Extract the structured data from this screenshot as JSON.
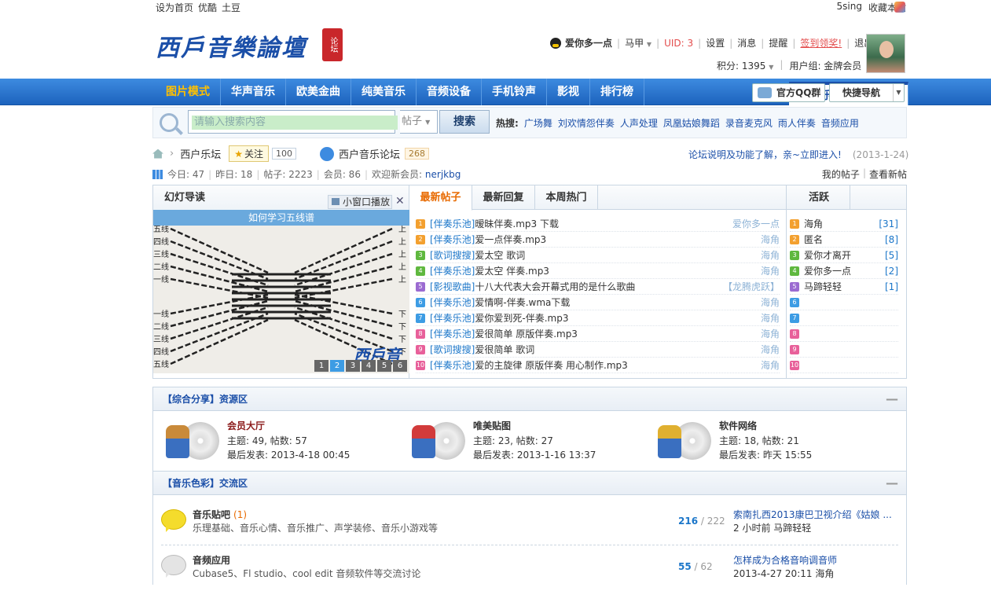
{
  "topbar": {
    "set_home": "设为首页",
    "youku": "优酷",
    "tudou": "土豆",
    "fivesing": "5sing",
    "bookmark": "收藏本站"
  },
  "logo": {
    "text": "西戶音樂論壇",
    "seal": "论坛"
  },
  "user": {
    "name": "爱你多一点",
    "maJia": "马甲",
    "uid": "UID: 3",
    "settings": "设置",
    "messages": "消息",
    "remind": "提醒",
    "signin": "签到领奖!",
    "logout": "退出",
    "points": "积分: 1395",
    "group": "用户组: 金牌会员"
  },
  "nav": {
    "items": [
      "西户乐坛",
      "图片模式",
      "华声音乐",
      "欧美金曲",
      "纯美音乐",
      "音频设备",
      "手机铃声",
      "影视",
      "排行榜"
    ],
    "qq_group": "官方QQ群",
    "quick_nav": "快捷导航"
  },
  "search": {
    "placeholder": "请输入搜索内容",
    "type": "帖子",
    "button": "搜索",
    "hot_label": "热搜:",
    "hot": [
      "广场舞",
      "刘欢情怨伴奏",
      "人声处理",
      "凤凰姑娘舞蹈",
      "录音麦克风",
      "雨人伴奏",
      "音频应用"
    ]
  },
  "crumb": {
    "home": "西户乐坛",
    "follow": "关注",
    "follow_count": "100",
    "forum": "西户音乐论坛",
    "forum_count": "268"
  },
  "notice": {
    "text": "论坛说明及功能了解，亲~立即进入!",
    "date": "(2013-1-24)"
  },
  "stats": {
    "today": "今日: 47",
    "yesterday": "昨日: 18",
    "posts": "帖子: 2223",
    "members": "会员: 86",
    "welcome": "欢迎新会员:",
    "newest": "nerjkbg"
  },
  "mylinks": {
    "my_posts": "我的帖子",
    "sep": "|",
    "new_posts": "查看新帖"
  },
  "slide": {
    "title": "幻灯导读",
    "mini": "小窗口播放",
    "close": "✕",
    "caption": "如何学习五线谱",
    "watermark": "西戶音",
    "pages": [
      "1",
      "2",
      "3",
      "4",
      "5",
      "6"
    ],
    "left_labels": [
      "五线",
      "四线",
      "三线",
      "二线",
      "一线",
      "一线",
      "二线",
      "三线",
      "四线",
      "五线"
    ],
    "right_labels": [
      "上",
      "上",
      "上",
      "上",
      "上",
      "下",
      "下",
      "下",
      "下",
      "下"
    ]
  },
  "tabs": {
    "items": [
      "最新帖子",
      "最新回复",
      "本周热门"
    ]
  },
  "threads": [
    {
      "n": "1",
      "cat": "[伴奏乐池]",
      "title": "暧昧伴奏.mp3 下载",
      "author": "爱你多一点",
      "color": "#f3a02f"
    },
    {
      "n": "2",
      "cat": "[伴奏乐池]",
      "title": "爱一点伴奏.mp3",
      "author": "海角",
      "color": "#f3a02f"
    },
    {
      "n": "3",
      "cat": "[歌词搜搜]",
      "title": "爱太空 歌词",
      "author": "海角",
      "color": "#5fb83f"
    },
    {
      "n": "4",
      "cat": "[伴奏乐池]",
      "title": "爱太空 伴奏.mp3",
      "author": "海角",
      "color": "#5fb83f"
    },
    {
      "n": "5",
      "cat": "[影视歌曲]",
      "title": "十八大代表大会开幕式用的是什么歌曲",
      "author": "【龙腾虎跃】",
      "color": "#9b6bd1"
    },
    {
      "n": "6",
      "cat": "[伴奏乐池]",
      "title": "爱情啊-伴奏.wma下载",
      "author": "海角",
      "color": "#3d9ce4"
    },
    {
      "n": "7",
      "cat": "[伴奏乐池]",
      "title": "爱你爱到死-伴奏.mp3",
      "author": "海角",
      "color": "#3d9ce4"
    },
    {
      "n": "8",
      "cat": "[伴奏乐池]",
      "title": "爱很简单 原版伴奏.mp3",
      "author": "海角",
      "color": "#e8609a"
    },
    {
      "n": "9",
      "cat": "[歌词搜搜]",
      "title": "爱很简单 歌词",
      "author": "海角",
      "color": "#e8609a"
    },
    {
      "n": "10",
      "cat": "[伴奏乐池]",
      "title": "爱的主旋律 原版伴奏 用心制作.mp3",
      "author": "海角",
      "color": "#e8609a"
    }
  ],
  "active": {
    "title": "活跃",
    "items": [
      {
        "n": "1",
        "name": "海角",
        "count": "[31]",
        "color": "#f3a02f"
      },
      {
        "n": "2",
        "name": "匿名",
        "count": "[8]",
        "color": "#f3a02f"
      },
      {
        "n": "3",
        "name": "爱你才离开",
        "count": "[5]",
        "color": "#5fb83f"
      },
      {
        "n": "4",
        "name": "爱你多一点",
        "count": "[2]",
        "color": "#5fb83f"
      },
      {
        "n": "5",
        "name": "马蹄轻轻",
        "count": "[1]",
        "color": "#9b6bd1"
      },
      {
        "n": "6",
        "name": "",
        "count": "",
        "color": "#3d9ce4"
      },
      {
        "n": "7",
        "name": "",
        "count": "",
        "color": "#3d9ce4"
      },
      {
        "n": "8",
        "name": "",
        "count": "",
        "color": "#e8609a"
      },
      {
        "n": "9",
        "name": "",
        "count": "",
        "color": "#e8609a"
      },
      {
        "n": "10",
        "name": "",
        "count": "",
        "color": "#e8609a"
      }
    ]
  },
  "section1": {
    "title": "【综合分享】资源区",
    "min": "—",
    "forums": [
      {
        "name": "会员大厅",
        "topics": "主题: 49, 帖数: 57",
        "last": "最后发表: 2013-4-18 00:45"
      },
      {
        "name": "唯美贴图",
        "topics": "主题: 23, 帖数: 27",
        "last": "最后发表: 2013-1-16 13:37"
      },
      {
        "name": "软件网络",
        "topics": "主题: 18, 帖数: 21",
        "last": "最后发表: 昨天 15:55"
      }
    ]
  },
  "section2": {
    "title": "【音乐色彩】交流区",
    "min": "—",
    "rows": [
      {
        "name": "音乐贴吧",
        "new": "(1)",
        "desc": "乐理基础、音乐心情、音乐推广、声学装修、音乐小游戏等",
        "threads": "216",
        "posts": " / 222",
        "last_title": "索南扎西2013康巴卫视介绍《姑娘 ...",
        "last_meta": "2 小时前 马蹄轻轻"
      },
      {
        "name": "音频应用",
        "new": "",
        "desc": "Cubase5、Fl studio、cool edit 音频软件等交流讨论",
        "threads": "55",
        "posts": " / 62",
        "last_title": "怎样成为合格音响调音师",
        "last_meta": "2013-4-27 20:11 海角"
      }
    ]
  }
}
